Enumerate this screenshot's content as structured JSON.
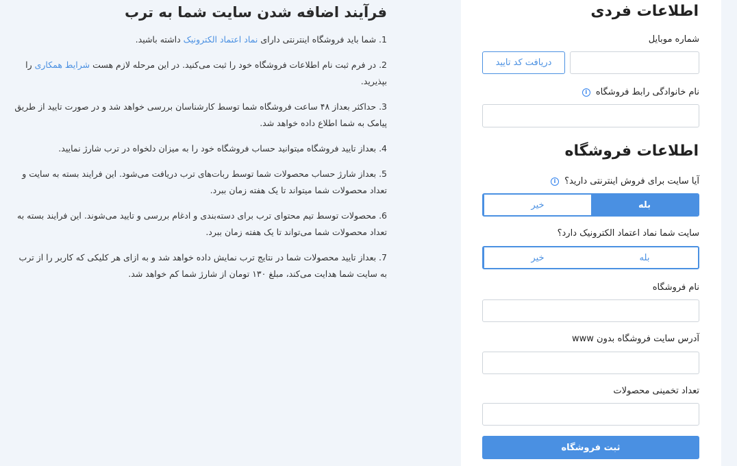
{
  "left": {
    "title": "فرآیند اضافه شدن سایت شما به ترب",
    "steps": [
      {
        "pre": "1. شما باید فروشگاه اینترنتی دارای ",
        "link": "نماد اعتماد الکترونیک",
        "post": " داشته باشید."
      },
      {
        "pre": "2. در فرم ثبت نام اطلاعات فروشگاه خود را ثبت می‌کنید. در این مرحله لازم هست ",
        "link": "شرایط همکاری",
        "post": " را بپذیرید."
      },
      {
        "pre": "3. حداکثر بعداز ۴۸ ساعت فروشگاه شما توسط کارشناسان بررسی خواهد شد و در صورت تایید از طریق پیامک به شما اطلاع داده خواهد شد.",
        "link": "",
        "post": ""
      },
      {
        "pre": "4. بعداز تایید فروشگاه میتوانید حساب فروشگاه خود را به میزان دلخواه در ترب شارژ نمایید.",
        "link": "",
        "post": ""
      },
      {
        "pre": "5. بعداز شارژ حساب محصولات شما توسط ربات‌های ترب دریافت می‌شود. این فرایند بسته به سایت و تعداد محصولات شما میتواند تا یک هفته زمان ببرد.",
        "link": "",
        "post": ""
      },
      {
        "pre": "6. محصولات توسط تیم محتوای ترب برای دسته‌بندی و ادغام بررسی و تایید می‌شوند. این فرایند بسته به تعداد محصولات شما می‌تواند تا یک هفته زمان ببرد.",
        "link": "",
        "post": ""
      },
      {
        "pre": "7. بعداز تایید محصولات شما در نتایج ترب نمایش داده خواهد شد و به ازای هر کلیکی که کاربر را از ترب به سایت شما هدایت می‌کند، مبلغ ۱۳۰ تومان از شارژ شما کم خواهد شد.",
        "link": "",
        "post": ""
      }
    ]
  },
  "form": {
    "personal_heading": "اطلاعات فردی",
    "mobile_label": "شماره موبایل",
    "get_code_button": "دریافت کد تایید",
    "manager_label": "نام خانوادگی رابط فروشگاه",
    "shop_heading": "اطلاعات فروشگاه",
    "online_question": "آیا سایت برای فروش اینترنتی دارید؟",
    "enamad_question": "سایت شما نماد اعتماد الکترونیک دارد؟",
    "yes": "بله",
    "no": "خیر",
    "shop_name_label": "نام فروشگاه",
    "site_label": "آدرس سایت فروشگاه بدون www",
    "products_label": "تعداد تخمینی محصولات",
    "submit_button": "ثبت فروشگاه",
    "info_icon": "i"
  },
  "colors": {
    "accent": "#4a90e2",
    "background": "#f1f5fa"
  }
}
